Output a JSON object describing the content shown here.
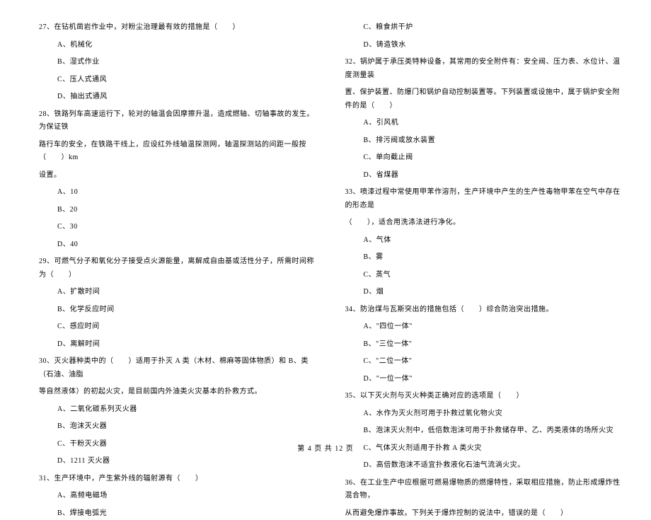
{
  "left_column": {
    "q27": {
      "text": "27、在钻机凿岩作业中，对粉尘治理最有效的措施是（　　）",
      "options": [
        "A、机械化",
        "B、湿式作业",
        "C、压人式通风",
        "D、抽出式通风"
      ]
    },
    "q28": {
      "line1": "28、铁路列车高速运行下，轮对的轴温会因摩擦升温，造成燃轴、切轴事故的发生。为保证铁",
      "line2": "路行车的安全，在铁路干线上，应设红外线轴温探测网，轴温探测站的间距一般按（　　）km",
      "line3": "设置。",
      "options": [
        "A、10",
        "B、20",
        "C、30",
        "D、40"
      ]
    },
    "q29": {
      "text": "29、可燃气分子和氧化分子接受点火源能量，离解成自由基或活性分子，所需时间称为（　　）",
      "options": [
        "A、扩散时间",
        "B、化学反应时间",
        "C、感应时间",
        "D、离解时间"
      ]
    },
    "q30": {
      "line1": "30、灭火器种类中的（　　）适用于扑灭 A 类（木材、棉麻等固体物质）和 B、类（石油、油脂",
      "line2": "等自然液体）的初起火灾，是目前国内外油类火灾基本的扑救方式。",
      "options": [
        "A、二氧化碳系列灭火器",
        "B、泡沫灭火器",
        "C、干粉灭火器",
        "D、1211 灭火器"
      ]
    },
    "q31": {
      "text": "31、生产环境中，产生紫外线的辐射源有（　　）",
      "options": [
        "A、高频电磁场",
        "B、焊接电弧光"
      ]
    }
  },
  "right_column": {
    "q31_cont": {
      "options": [
        "C、粮食烘干炉",
        "D、铸造铁水"
      ]
    },
    "q32": {
      "line1": "32、锅炉属于承压类特种设备，其常用的安全附件有：安全阀、压力表、水位计、温度测量装",
      "line2": "置、保护装置、防爆门和锅炉自动控制装置等。下列装置或设施中，属于锅炉安全附件的是（　　）",
      "options": [
        "A、引风机",
        "B、排污阀或放水装置",
        "C、单向截止阀",
        "D、省煤器"
      ]
    },
    "q33": {
      "line1": "33、喷漆过程中常使用甲苯作溶剂，生产环境中产生的生产性毒物甲苯在空气中存在的形态是",
      "line2": "（　　），适合用洗涤法进行净化。",
      "options": [
        "A、气体",
        "B、雾",
        "C、蒸气",
        "D、烟"
      ]
    },
    "q34": {
      "text": "34、防治煤与瓦斯突出的措施包括（　　）综合防治突出措施。",
      "options": [
        "A、\"四位一体\"",
        "B、\"三位一体\"",
        "C、\"二位一体\"",
        "D、\"一位一体\""
      ]
    },
    "q35": {
      "text": "35、以下灭火剂与灭火种类正确对应的选项是（　　）",
      "options": [
        "A、水作为灭火剂可用于扑救过氧化物火灾",
        "B、泡沫灭火剂中，低倍数泡沫可用于扑救储存甲、乙、丙类液体的场所火灾",
        "C、气体灭火剂适用于扑救 A 类火灾",
        "D、高倍数泡沫不适宜扑救液化石油气流淌火灾。"
      ]
    },
    "q36": {
      "line1": "36、在工业生产中应根据可燃易爆物质的燃爆特性，采取相应措施，防止形成爆炸性混合物，",
      "line2": "从而避免爆炸事故。下列关于爆炸控制的说法中，错误的是（　　）"
    }
  },
  "footer": "第 4 页 共 12 页"
}
